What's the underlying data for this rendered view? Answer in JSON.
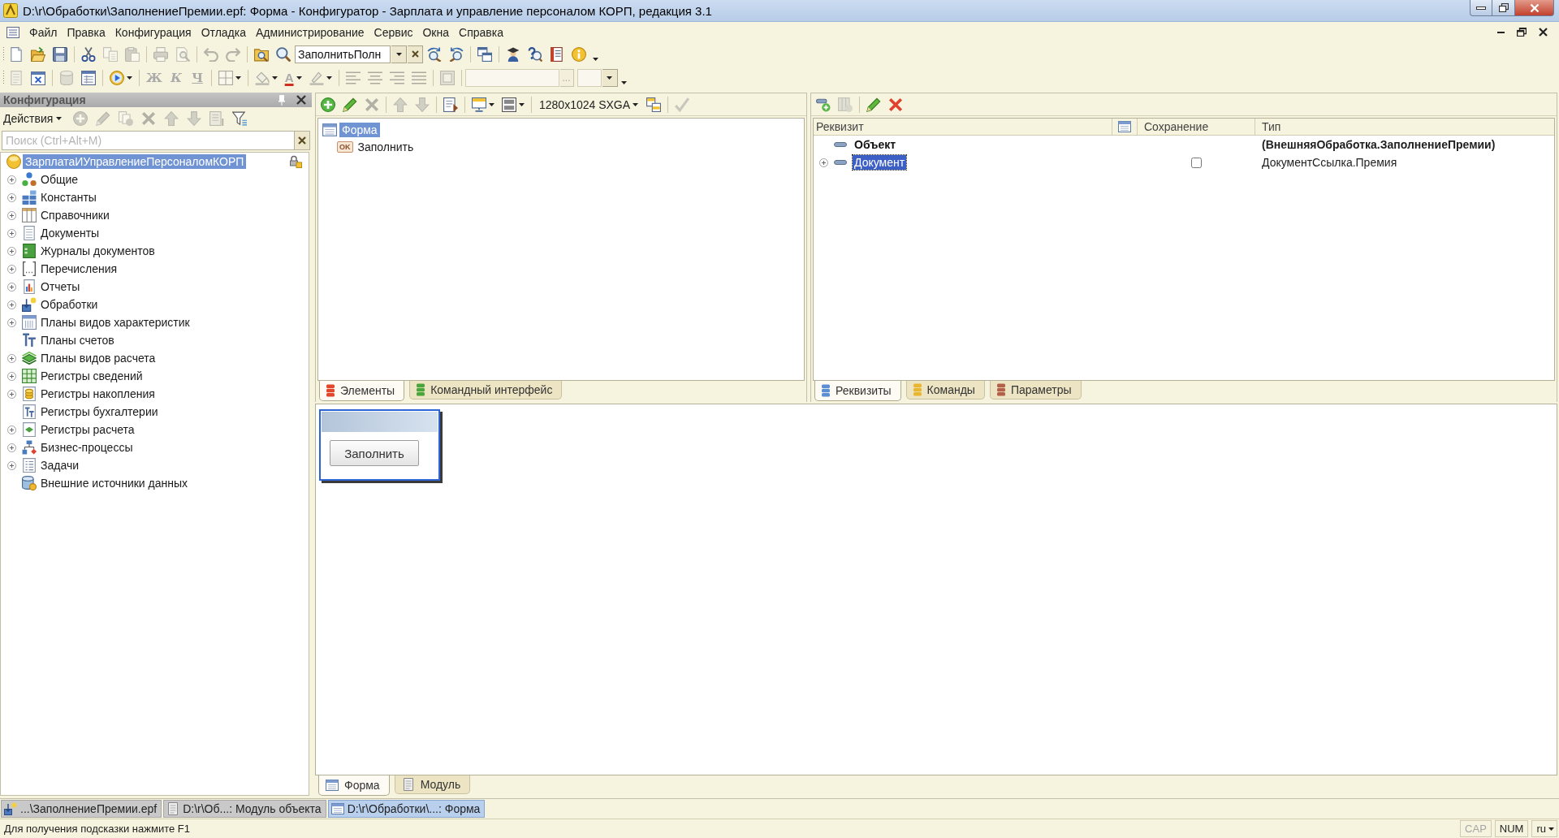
{
  "window": {
    "title": "D:\\r\\Обработки\\ЗаполнениеПремии.epf: Форма - Конфигуратор - Зарплата и управление персоналом КОРП, редакция 3.1"
  },
  "menu": [
    "Файл",
    "Правка",
    "Конфигурация",
    "Отладка",
    "Администрирование",
    "Сервис",
    "Окна",
    "Справка"
  ],
  "toolbar_main": {
    "overflow": true,
    "groups": [
      [
        {
          "kind": "new",
          "disabled": false,
          "has_menu": false
        },
        {
          "kind": "open",
          "disabled": false,
          "has_menu": false
        },
        {
          "kind": "save",
          "disabled": false,
          "has_menu": false
        }
      ],
      [
        {
          "kind": "cut",
          "disabled": false,
          "has_menu": false
        },
        {
          "kind": "copy",
          "disabled": true,
          "has_menu": false
        },
        {
          "kind": "paste",
          "disabled": true,
          "has_menu": false
        }
      ],
      [
        {
          "kind": "print",
          "disabled": true,
          "has_menu": false
        },
        {
          "kind": "preview",
          "disabled": true,
          "has_menu": false
        }
      ],
      [
        {
          "kind": "undo",
          "disabled": true,
          "has_menu": false
        },
        {
          "kind": "redo",
          "disabled": true,
          "has_menu": false
        }
      ],
      [
        {
          "kind": "find_in_files",
          "disabled": false,
          "has_menu": false
        },
        {
          "kind": "search",
          "disabled": false,
          "has_menu": false
        },
        {
          "kind": "search_combo",
          "value": "ЗаполнитьПолн",
          "disabled": false
        },
        {
          "kind": "find_next",
          "disabled": false,
          "has_menu": false
        },
        {
          "kind": "find_prev",
          "disabled": false,
          "has_menu": false
        }
      ],
      [
        {
          "kind": "windows",
          "disabled": false,
          "has_menu": false
        }
      ],
      [
        {
          "kind": "wizard",
          "disabled": false,
          "has_menu": false
        },
        {
          "kind": "syntax_help",
          "disabled": false,
          "has_menu": false
        },
        {
          "kind": "description",
          "disabled": false,
          "has_menu": false
        },
        {
          "kind": "info",
          "disabled": false,
          "has_menu": false
        }
      ]
    ]
  },
  "toolbar_format": {
    "overflow": true,
    "groups": [
      [
        {
          "kind": "module",
          "disabled": true,
          "has_menu": false
        },
        {
          "kind": "form_design",
          "disabled": false,
          "has_menu": false
        }
      ],
      [
        {
          "kind": "database",
          "disabled": true,
          "has_menu": false
        },
        {
          "kind": "table_window",
          "disabled": false,
          "has_menu": false
        }
      ],
      [
        {
          "kind": "run",
          "disabled": false,
          "has_menu": true
        }
      ],
      [
        {
          "kind": "bold",
          "label": "Ж",
          "disabled": true,
          "has_menu": false
        },
        {
          "kind": "italic",
          "label": "К",
          "disabled": true,
          "has_menu": false
        },
        {
          "kind": "underline",
          "label": "Ч",
          "disabled": true,
          "has_menu": false
        }
      ],
      [
        {
          "kind": "borders",
          "disabled": true,
          "has_menu": true
        }
      ],
      [
        {
          "kind": "fill",
          "disabled": true,
          "has_menu": true
        },
        {
          "kind": "font_color",
          "label": "A",
          "disabled": true,
          "has_menu": true
        },
        {
          "kind": "highlight",
          "disabled": true,
          "has_menu": true
        }
      ],
      [
        {
          "kind": "align_left",
          "disabled": true,
          "has_menu": false
        },
        {
          "kind": "align_center",
          "disabled": true,
          "has_menu": false
        },
        {
          "kind": "align_right",
          "disabled": true,
          "has_menu": false
        },
        {
          "kind": "align_justify",
          "disabled": true,
          "has_menu": false
        }
      ],
      [
        {
          "kind": "frame",
          "disabled": true,
          "has_menu": false
        }
      ],
      [
        {
          "kind": "text_field",
          "button": "...",
          "disabled": true
        },
        {
          "kind": "combo",
          "disabled": true
        }
      ]
    ]
  },
  "config_panel": {
    "title": "Конфигурация",
    "actions": {
      "label": "Действия",
      "groups": [
        [
          {
            "kind": "add",
            "disabled": true,
            "has_menu": false
          },
          {
            "kind": "edit",
            "disabled": true,
            "has_menu": false
          },
          {
            "kind": "copy_item",
            "disabled": true,
            "has_menu": false
          },
          {
            "kind": "delete",
            "disabled": true,
            "has_menu": false
          },
          {
            "kind": "move_up",
            "disabled": true,
            "has_menu": false
          },
          {
            "kind": "move_down",
            "disabled": true,
            "has_menu": false
          },
          {
            "kind": "sort",
            "disabled": true,
            "has_menu": false
          },
          {
            "kind": "filter",
            "disabled": false,
            "has_menu": false
          }
        ]
      ]
    },
    "search": {
      "placeholder": "Поиск (Ctrl+Alt+M)"
    },
    "tree": {
      "label": "ЗарплатаИУправлениеПерсоналомКОРП",
      "selected": true,
      "locked": true,
      "children": [
        {
          "label": "Общие",
          "kind": "common",
          "expandable": true,
          "selected": false
        },
        {
          "label": "Константы",
          "kind": "constants",
          "expandable": true,
          "selected": false
        },
        {
          "label": "Справочники",
          "kind": "catalogs",
          "expandable": true,
          "selected": false
        },
        {
          "label": "Документы",
          "kind": "documents",
          "expandable": true,
          "selected": false
        },
        {
          "label": "Журналы документов",
          "kind": "journals",
          "expandable": true,
          "selected": false
        },
        {
          "label": "Перечисления",
          "kind": "enums",
          "expandable": true,
          "selected": false
        },
        {
          "label": "Отчеты",
          "kind": "reports",
          "expandable": true,
          "selected": false
        },
        {
          "label": "Обработки",
          "kind": "processors",
          "expandable": true,
          "selected": false
        },
        {
          "label": "Планы видов характеристик",
          "kind": "characteristic_plans",
          "expandable": true,
          "selected": false
        },
        {
          "label": "Планы счетов",
          "kind": "account_plans",
          "expandable": false,
          "selected": false
        },
        {
          "label": "Планы видов расчета",
          "kind": "calculation_plans",
          "expandable": true,
          "selected": false
        },
        {
          "label": "Регистры сведений",
          "kind": "info_registers",
          "expandable": true,
          "selected": false
        },
        {
          "label": "Регистры накопления",
          "kind": "accumulation_registers",
          "expandable": true,
          "selected": false
        },
        {
          "label": "Регистры бухгалтерии",
          "kind": "accounting_registers",
          "expandable": false,
          "selected": false
        },
        {
          "label": "Регистры расчета",
          "kind": "calculation_registers",
          "expandable": true,
          "selected": false
        },
        {
          "label": "Бизнес-процессы",
          "kind": "business_processes",
          "expandable": true,
          "selected": false
        },
        {
          "label": "Задачи",
          "kind": "tasks",
          "expandable": true,
          "selected": false
        },
        {
          "label": "Внешние источники данных",
          "kind": "external_sources",
          "expandable": false,
          "selected": false
        }
      ]
    }
  },
  "elements_panel": {
    "toolbar": {
      "groups": [
        [
          {
            "kind": "add",
            "disabled": false,
            "has_menu": false
          },
          {
            "kind": "edit",
            "disabled": false,
            "has_menu": false
          },
          {
            "kind": "delete",
            "disabled": true,
            "has_menu": false
          }
        ],
        [
          {
            "kind": "move_up",
            "disabled": true,
            "has_menu": false
          },
          {
            "kind": "move_down",
            "disabled": true,
            "has_menu": false
          }
        ],
        [
          {
            "kind": "command",
            "disabled": false,
            "has_menu": false
          }
        ],
        [
          {
            "kind": "monitor",
            "disabled": false,
            "has_menu": true
          },
          {
            "kind": "layout",
            "disabled": false,
            "has_menu": true
          }
        ],
        [
          {
            "kind": "resolution",
            "label": "1280x1024 SXGA",
            "disabled": false,
            "has_menu": true
          },
          {
            "kind": "copy_layout",
            "disabled": false,
            "has_menu": false
          }
        ],
        [
          {
            "kind": "check",
            "disabled": true,
            "has_menu": false
          }
        ]
      ]
    },
    "tree": [
      {
        "label": "Форма",
        "kind": "form",
        "selected": true,
        "children": [
          {
            "label": "Заполнить",
            "kind": "button",
            "badge": "OK",
            "selected": false
          }
        ]
      }
    ],
    "tabs": [
      {
        "label": "Элементы",
        "selected": true,
        "color": "#e2472c"
      },
      {
        "label": "Командный интерфейс",
        "selected": false,
        "color": "#4aa53a"
      }
    ]
  },
  "attributes_panel": {
    "toolbar": {
      "groups": [
        [
          {
            "kind": "add_attribute",
            "disabled": false,
            "has_menu": false
          },
          {
            "kind": "add_column",
            "disabled": true,
            "has_menu": false
          }
        ],
        [
          {
            "kind": "edit",
            "disabled": false,
            "has_menu": false
          },
          {
            "kind": "delete",
            "disabled": false,
            "has_menu": false
          }
        ]
      ]
    },
    "columns": [
      "Реквизит",
      "Сохранение",
      "Тип"
    ],
    "rows": [
      {
        "kind": "main",
        "name": "Объект",
        "type": "(ВнешняяОбработка.ЗаполнениеПремии)",
        "expandable": false,
        "selected": false
      },
      {
        "kind": "attribute",
        "name": "Документ",
        "saved": false,
        "type": "ДокументСсылка.Премия",
        "expandable": true,
        "selected": true
      }
    ],
    "tabs": [
      {
        "label": "Реквизиты",
        "selected": true,
        "color": "#5b8ed2"
      },
      {
        "label": "Команды",
        "selected": false,
        "color": "#e9b72f"
      },
      {
        "label": "Параметры",
        "selected": false,
        "color": "#b2604a"
      }
    ]
  },
  "form_preview": {
    "button": "Заполнить"
  },
  "editor_tabs": [
    {
      "label": "Форма",
      "kind": "form",
      "selected": true
    },
    {
      "label": "Модуль",
      "kind": "module",
      "selected": false
    }
  ],
  "window_tabs": [
    {
      "label": "...\\ЗаполнениеПремии.epf",
      "kind": "processing",
      "selected": false
    },
    {
      "label": "D:\\r\\Об...: Модуль объекта",
      "kind": "module",
      "selected": false
    },
    {
      "label": "D:\\r\\Обработки\\...: Форма",
      "kind": "form",
      "selected": true
    }
  ],
  "status_bar": {
    "hint": "Для получения подсказки нажмите F1",
    "indicators": [
      {
        "label": "CAP",
        "on": false
      },
      {
        "label": "NUM",
        "on": true
      }
    ],
    "language": "ru"
  }
}
